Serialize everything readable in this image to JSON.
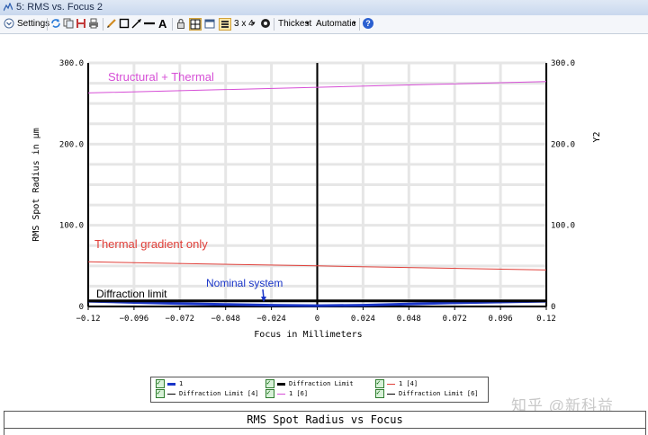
{
  "window": {
    "title": "5: RMS vs. Focus 2"
  },
  "toolbar": {
    "settings_label": "Settings",
    "layout_label": "3 x 4",
    "line_label": "Thickest",
    "scale_label": "Automatic",
    "help_label": "?"
  },
  "chart_data": {
    "type": "line",
    "title": "",
    "xlabel": "Focus in Millimeters",
    "ylabel": "RMS Spot Radius in µm",
    "y2label": "Y2",
    "xlim": [
      -0.12,
      0.12
    ],
    "ylim": [
      0,
      300
    ],
    "x_ticks": [
      "−0.12",
      "−0.096",
      "−0.072",
      "−0.048",
      "−0.024",
      "0",
      "0.024",
      "0.048",
      "0.072",
      "0.096",
      "0.12"
    ],
    "y_ticks": [
      "0",
      "100.0",
      "200.0",
      "300.0"
    ],
    "y2_ticks": [
      "0",
      "100.0",
      "200.0",
      "300.0"
    ],
    "grid": true,
    "series": [
      {
        "name": "1",
        "color": "#1a35c8",
        "width": 3,
        "x": [
          -0.12,
          -0.096,
          -0.072,
          -0.048,
          -0.024,
          0,
          0.024,
          0.048,
          0.072,
          0.096,
          0.12
        ],
        "y": [
          6.5,
          5,
          3.5,
          2.5,
          1.5,
          1.0,
          1.5,
          3,
          4.5,
          5.5,
          6.5
        ]
      },
      {
        "name": "Diffraction Limit",
        "color": "#000000",
        "width": 3,
        "x": [
          -0.12,
          0.12
        ],
        "y": [
          7,
          7
        ]
      },
      {
        "name": "1 [4]",
        "color": "#e0403a",
        "width": 1,
        "x": [
          -0.12,
          -0.06,
          0,
          0.06,
          0.12
        ],
        "y": [
          55,
          52.5,
          50,
          47.5,
          45
        ]
      },
      {
        "name": "Diffraction Limit [4]",
        "color": "#000000",
        "width": 1,
        "x": [
          -0.12,
          0.12
        ],
        "y": [
          7,
          7
        ]
      },
      {
        "name": "1 [6]",
        "color": "#d64fd6",
        "width": 1,
        "x": [
          -0.12,
          -0.06,
          0,
          0.06,
          0.12
        ],
        "y": [
          263,
          266.5,
          270,
          273.5,
          277
        ]
      },
      {
        "name": "Diffraction Limit [6]",
        "color": "#000000",
        "width": 1,
        "x": [
          -0.12,
          0.12
        ],
        "y": [
          7,
          7
        ]
      }
    ],
    "annotations": [
      {
        "text": "Structural + Thermal",
        "color": "#d64fd6"
      },
      {
        "text": "Thermal gradient only",
        "color": "#e0403a"
      },
      {
        "text": "Nominal system",
        "color": "#1a35c8"
      },
      {
        "text": "Diffraction limit",
        "color": "#000000"
      }
    ]
  },
  "legend": {
    "items": [
      {
        "label": "1",
        "color": "#1a35c8"
      },
      {
        "label": "Diffraction Limit",
        "color": "#000000"
      },
      {
        "label": "1 [4]",
        "color": "#e0403a"
      },
      {
        "label": "Diffraction Limit [4]",
        "color": "#000000"
      },
      {
        "label": "1 [6]",
        "color": "#d64fd6"
      },
      {
        "label": "Diffraction Limit [6]",
        "color": "#000000"
      }
    ]
  },
  "table": {
    "title": "RMS Spot Radius vs Focus"
  },
  "watermark": "知乎 @新科益"
}
